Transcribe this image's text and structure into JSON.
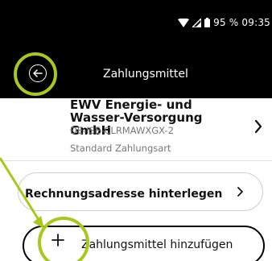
{
  "status_bar": {
    "time": "95 % 09:35",
    "icons": [
      "wifi-icon",
      "signal-icon",
      "battery-icon"
    ]
  },
  "app_bar": {
    "back_icon": "arrow-left-icon",
    "title": "Zahlungsmittel"
  },
  "payment_method": {
    "name": "EWV Energie- und Wasser-Versorgung GmbH",
    "id": "DE-ISE-CLRMAWXGX-2",
    "status": "Standard Zahlungsart",
    "chevron_icon": "chevron-right-icon"
  },
  "actions": {
    "billing_address_label": "Rechnungsadresse hinterlegen",
    "add_payment_label": "Zahlungsmittel hinzufügen",
    "add_icon": "plus-icon"
  },
  "annotations": {
    "highlight_color": "#a8c81e",
    "shapes": [
      "highlight-circle",
      "highlight-circle",
      "arrow"
    ]
  },
  "colors": {
    "app_bar_bg": "#000000",
    "text_primary": "#111111",
    "text_secondary": "#777777"
  }
}
